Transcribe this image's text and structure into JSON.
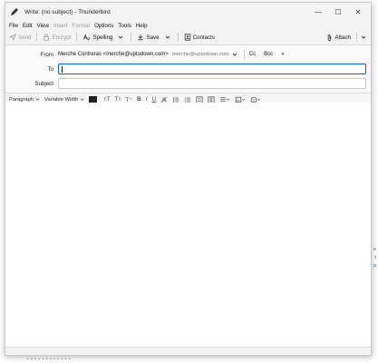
{
  "window": {
    "title": "Write: (no subject) - Thunderbird",
    "controls": {
      "minimize": "—",
      "maximize": "☐",
      "close": "✕"
    }
  },
  "menubar": {
    "items": [
      {
        "label": "File",
        "enabled": true
      },
      {
        "label": "Edit",
        "enabled": true
      },
      {
        "label": "View",
        "enabled": true
      },
      {
        "label": "Insert",
        "enabled": false
      },
      {
        "label": "Format",
        "enabled": false
      },
      {
        "label": "Options",
        "enabled": true
      },
      {
        "label": "Tools",
        "enabled": true
      },
      {
        "label": "Help",
        "enabled": true
      }
    ]
  },
  "toolbar": {
    "send_label": "Send",
    "encrypt_label": "Encrypt",
    "spelling_label": "Spelling",
    "save_label": "Save",
    "contacts_label": "Contacts",
    "attach_label": "Attach"
  },
  "header": {
    "from_label": "From",
    "from_value": "Merche Contreras <merche@uptodown.com>",
    "from_identity": "merche@uptodown.com",
    "cc_label": "Cc",
    "bcc_label": "Bcc",
    "more_label": "»",
    "to_label": "To",
    "to_value": "",
    "subject_label": "Subject",
    "subject_value": ""
  },
  "format_bar": {
    "paragraph_label": "Paragraph",
    "font_label": "Variable Width",
    "text_color": "#222222",
    "buttons": {
      "smaller_text": "тT",
      "larger_text": "Tт",
      "superscript": "T⁺",
      "bold": "B",
      "italic": "I",
      "underline": "U"
    }
  },
  "colors": {
    "accent": "#0a64c8",
    "chrome": "#f3f3f3"
  },
  "background": {
    "edge_texts": [
      "e",
      "t",
      "p"
    ],
    "bottom_text": "▪ ▪ ▪ ▪ ▪ ▪ ▪ ▪ ▪ ▪ ▪ ▪"
  }
}
